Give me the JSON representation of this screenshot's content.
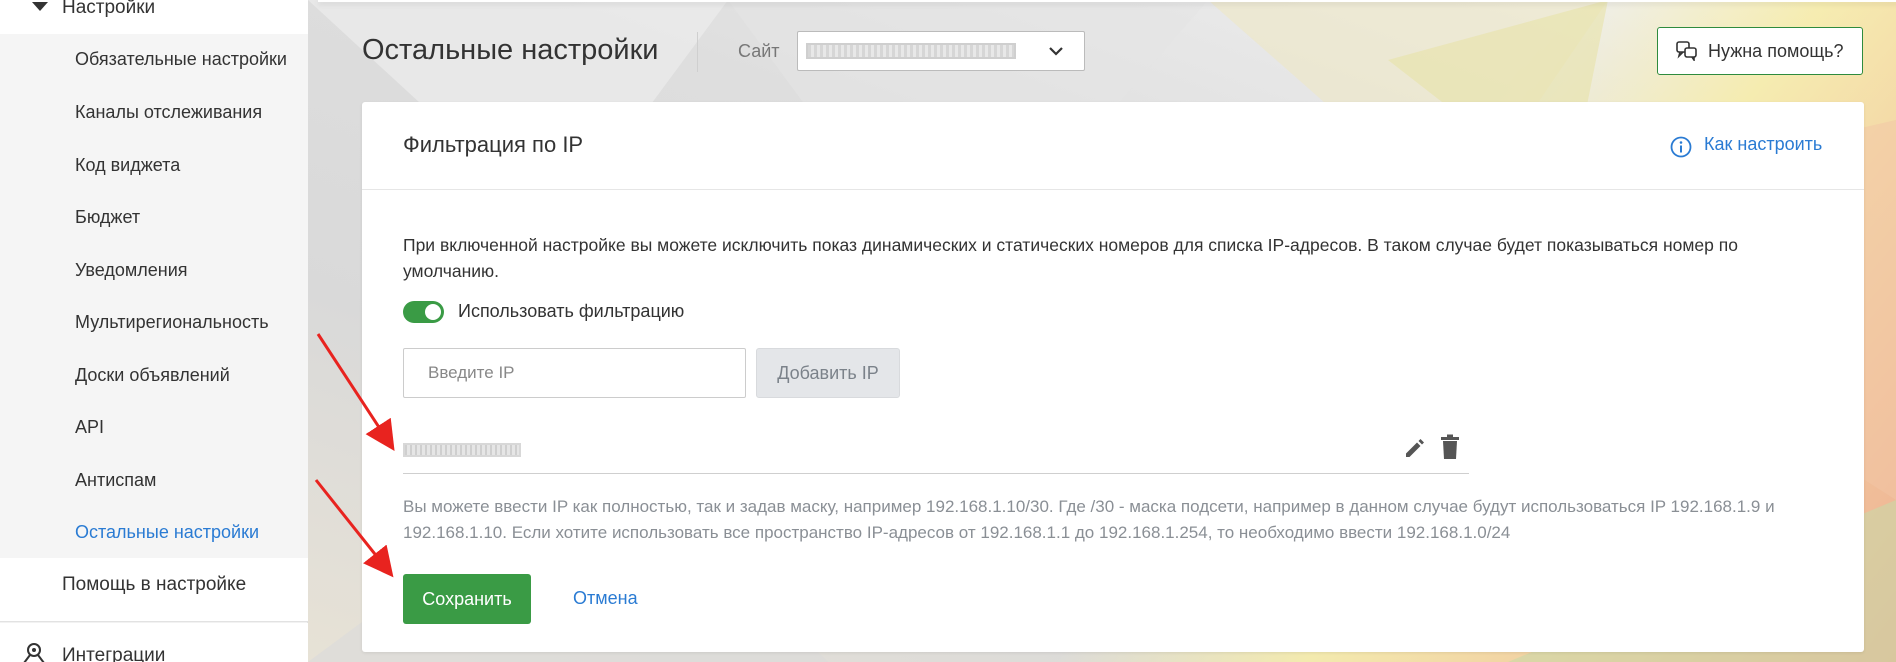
{
  "sidebar": {
    "group_label": "Настройки",
    "items": [
      {
        "label": "Обязательные настройки"
      },
      {
        "label": "Каналы отслеживания"
      },
      {
        "label": "Код виджета"
      },
      {
        "label": "Бюджет"
      },
      {
        "label": "Уведомления"
      },
      {
        "label": "Мультирегиональность"
      },
      {
        "label": "Доски объявлений"
      },
      {
        "label": "API"
      },
      {
        "label": "Антиспам"
      },
      {
        "label": "Остальные настройки",
        "active": true
      }
    ],
    "help_label": "Помощь в настройке",
    "integrations_label": "Интеграции"
  },
  "header": {
    "title": "Остальные настройки",
    "site_label": "Сайт",
    "site_value": "",
    "help_button": "Нужна помощь?"
  },
  "card": {
    "title": "Фильтрация по IP",
    "howto_link": "Как настроить",
    "description": "При включенной настройке вы можете исключить показ динамических и статических номеров для списка IP-адресов. В таком случае будет показываться номер по умолчанию.",
    "toggle_label": "Использовать фильтрацию",
    "toggle_on": true,
    "ip_input_placeholder": "Введите IP",
    "add_button": "Добавить IP",
    "ip_entries": [
      ""
    ],
    "hint": "Вы можете ввести IP как полностью, так и задав маску, например 192.168.1.10/30. Где /30 - маска подсети, например в данном случае будут использоваться IP 192.168.1.9 и 192.168.1.10. Если хотите использовать все пространство IP-адресов от 192.168.1.1 до 192.168.1.254, то необходимо ввести 192.168.1.0/24",
    "save_button": "Сохранить",
    "cancel_link": "Отмена"
  },
  "colors": {
    "accent_green": "#3a9b45",
    "link_blue": "#2a7bd3",
    "annotation_red": "#e8231f"
  },
  "icons": [
    "caret-down-icon",
    "integrations-icon",
    "chevron-down-icon",
    "chat-bubbles-icon",
    "info-icon",
    "pencil-icon",
    "trash-icon"
  ]
}
